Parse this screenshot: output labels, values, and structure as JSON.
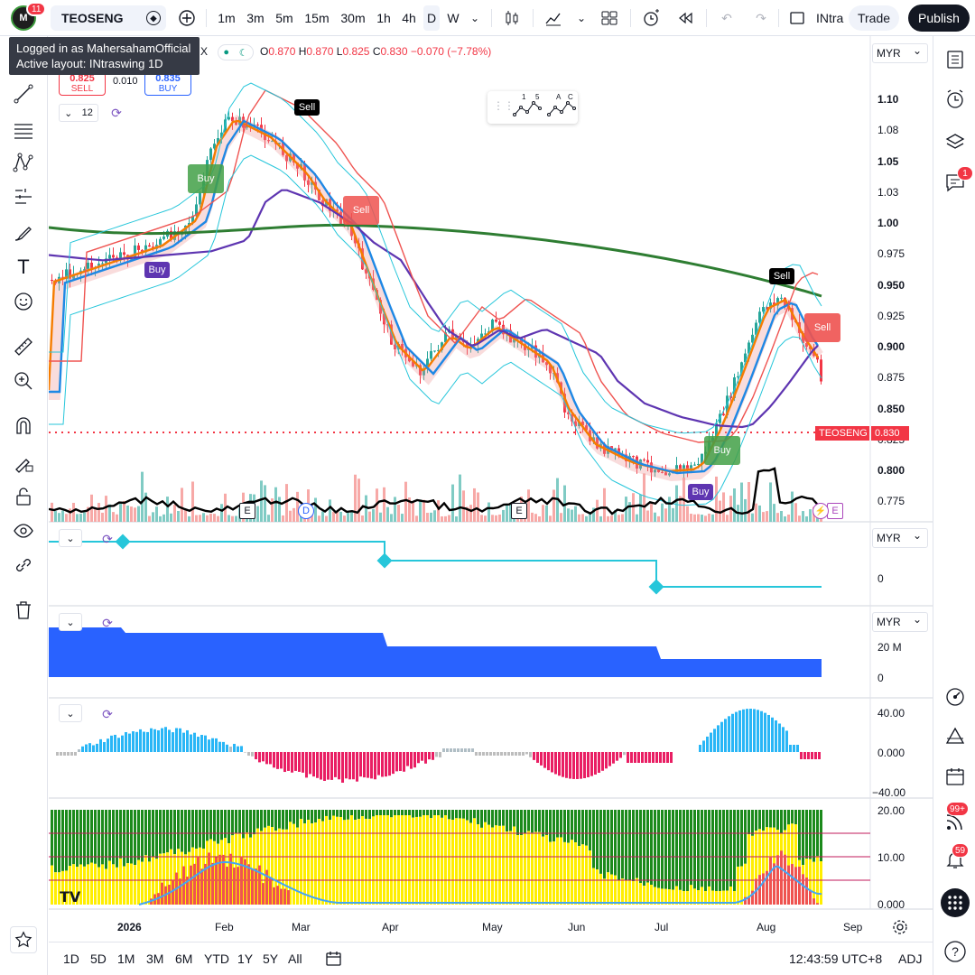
{
  "topbar": {
    "avatar_badge": "11",
    "symbol": "TEOSENG",
    "intervals": [
      "1m",
      "3m",
      "5m",
      "15m",
      "30m",
      "1h",
      "4h",
      "D",
      "W"
    ],
    "active_interval": "D",
    "layout_name_cut": "INtra",
    "trade_label": "Trade",
    "publish_label": "Publish"
  },
  "tooltip": {
    "line1": "Logged in as MahersahamOfficial",
    "line2": "Active layout: INtraswing 1D"
  },
  "legend": {
    "exchange_cut": "X",
    "o_label": "O",
    "o_val": "0.870",
    "h_label": "H",
    "h_val": "0.870",
    "l_label": "L",
    "l_val": "0.825",
    "c_label": "C",
    "c_val": "0.830",
    "change": "−0.070 (−7.78%)",
    "sell_price": "0.825",
    "sell_label": "SELL",
    "spread": "0.010",
    "buy_price": "0.835",
    "buy_label": "BUY",
    "indicator_count": "12"
  },
  "mini_toolbar": {
    "a": "1",
    "b": "5",
    "c": "A",
    "d": "C"
  },
  "price_axis": {
    "currency": "MYR",
    "ticks": [
      "1.10",
      "1.08",
      "1.05",
      "1.03",
      "1.00",
      "0.975",
      "0.950",
      "0.925",
      "0.900",
      "0.875",
      "0.850",
      "0.825",
      "0.800",
      "0.775"
    ],
    "bold_ticks": [
      "1.10",
      "1.05",
      "1.00",
      "0.950",
      "0.900",
      "0.850",
      "0.800"
    ],
    "last_price": "0.830",
    "last_symbol": "TEOSENG"
  },
  "signals": {
    "buy1": "Buy",
    "buy2": "Buy",
    "sell1": "Sell",
    "sell2": "Sell",
    "buy3": "Buy",
    "buy4": "Buy",
    "sell3": "Sell",
    "sell4": "Sell",
    "event_e": "E",
    "event_d": "D"
  },
  "pane2": {
    "currency": "MYR",
    "tick": "0"
  },
  "pane3": {
    "currency": "MYR",
    "ticks": [
      "20 M",
      "0"
    ]
  },
  "pane4": {
    "ticks": [
      "40.00",
      "0.000",
      "−40.00"
    ]
  },
  "pane5": {
    "ticks": [
      "20.00",
      "10.00",
      "0.000"
    ]
  },
  "time_axis": [
    "2026",
    "Feb",
    "Mar",
    "Apr",
    "May",
    "Jun",
    "Jul",
    "Aug",
    "Sep"
  ],
  "bottombar": {
    "ranges": [
      "1D",
      "5D",
      "1M",
      "3M",
      "6M",
      "YTD",
      "1Y",
      "5Y",
      "All"
    ],
    "clock": "12:43:59 UTC+8",
    "adj": "ADJ"
  },
  "right_badges": {
    "chat": "1",
    "ideas": "99+",
    "alerts": "59"
  },
  "colors": {
    "up": "#26a69a",
    "down": "#f23645",
    "accent": "#2962ff"
  }
}
